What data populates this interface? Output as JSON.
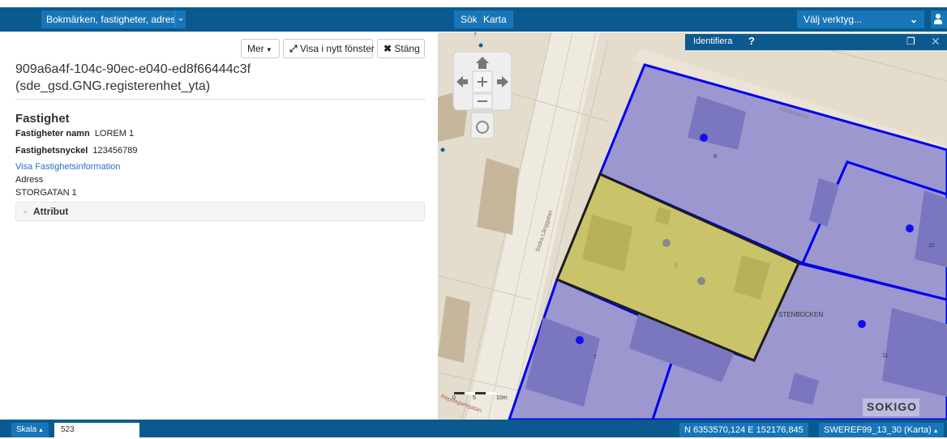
{
  "header": {
    "bookmarks_label": "Bokmärken, fastigheter, adres…",
    "search_tab": "Sök",
    "map_tab": "Karta",
    "tools_label": "Välj verktyg..."
  },
  "panel": {
    "more_button": "Mer",
    "open_new_window_button": "Visa i nytt fönster",
    "close_button": "Stäng",
    "object_id": "909a6a4f-104c-90ec-e040-ed8f66444c3f",
    "layer_name": "(sde_gsd.GNG.registerenhet_yta)",
    "section_title": "Fastighet",
    "property_name_label": "Fastigheter namn",
    "property_name_value": "LOREM 1",
    "property_key_label": "Fastighetsnyckel",
    "property_key_value": "123456789",
    "info_link": "Visa Fastighetsinformation",
    "address_label": "Adress",
    "address_value": "STORGATAN 1",
    "attributes_label": "Attribut"
  },
  "map": {
    "identify_title": "Identifiera",
    "identify_help": "?",
    "street_labels": [
      "Västergatan",
      "Södra Långgatan",
      "Repslagaregatan"
    ],
    "block_name": "STENBOCKEN",
    "lot_numbers": [
      "9",
      "10",
      "7",
      "11",
      "8",
      "7"
    ],
    "scalebar_ticks": [
      "0",
      "5",
      "10m"
    ],
    "logo": "SOKIGO",
    "colors": {
      "parcel_fill": "#8f8ccf",
      "parcel_border": "#0000ee",
      "selected_fill": "#c9c46a",
      "selected_border": "#1d1d1d",
      "building": "#7a76c0",
      "ground": "#e4ddcd"
    }
  },
  "footer": {
    "scale_label": "Skala",
    "scale_value": "523",
    "coordinates": "N 6353570,124 E 152176,845",
    "crs": "SWEREF99_13_30 (Karta)"
  }
}
